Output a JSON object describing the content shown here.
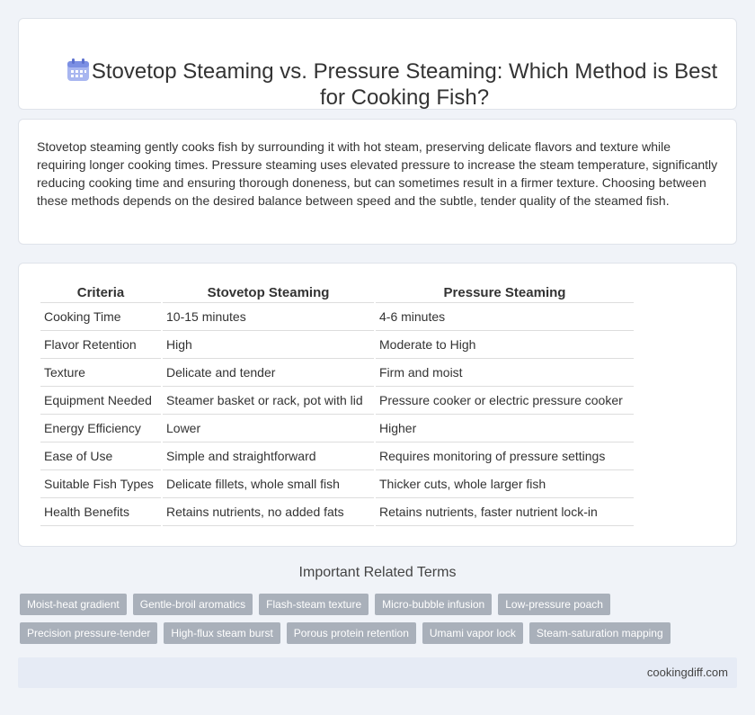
{
  "header": {
    "title": "Stovetop Steaming vs. Pressure Steaming: Which Method is Best for Cooking Fish?",
    "icon": "calendar-icon"
  },
  "intro": {
    "text": "Stovetop steaming gently cooks fish by surrounding it with hot steam, preserving delicate flavors and texture while requiring longer cooking times. Pressure steaming uses elevated pressure to increase the steam temperature, significantly reducing cooking time and ensuring thorough doneness, but can sometimes result in a firmer texture. Choosing between these methods depends on the desired balance between speed and the subtle, tender quality of the steamed fish."
  },
  "table": {
    "headers": [
      "Criteria",
      "Stovetop Steaming",
      "Pressure Steaming"
    ],
    "rows": [
      [
        "Cooking Time",
        "10-15 minutes",
        "4-6 minutes"
      ],
      [
        "Flavor Retention",
        "High",
        "Moderate to High"
      ],
      [
        "Texture",
        "Delicate and tender",
        "Firm and moist"
      ],
      [
        "Equipment Needed",
        "Steamer basket or rack, pot with lid",
        "Pressure cooker or electric pressure cooker"
      ],
      [
        "Energy Efficiency",
        "Lower",
        "Higher"
      ],
      [
        "Ease of Use",
        "Simple and straightforward",
        "Requires monitoring of pressure settings"
      ],
      [
        "Suitable Fish Types",
        "Delicate fillets, whole small fish",
        "Thicker cuts, whole larger fish"
      ],
      [
        "Health Benefits",
        "Retains nutrients, no added fats",
        "Retains nutrients, faster nutrient lock-in"
      ]
    ]
  },
  "related": {
    "title": "Important Related Terms",
    "rows": [
      [
        "Moist-heat gradient",
        "Gentle-broil aromatics",
        "Flash-steam texture",
        "Micro-bubble infusion",
        "Low-pressure poach"
      ],
      [
        "Precision pressure-tender",
        "High-flux steam burst",
        "Porous protein retention",
        "Umami vapor lock",
        "Steam-saturation mapping"
      ]
    ]
  },
  "footer": {
    "site": "cookingdiff.com"
  },
  "colors": {
    "accent": "#6a7fd6",
    "tag_bg": "#a9b0ba",
    "footer_bg": "#e6ebf5"
  }
}
